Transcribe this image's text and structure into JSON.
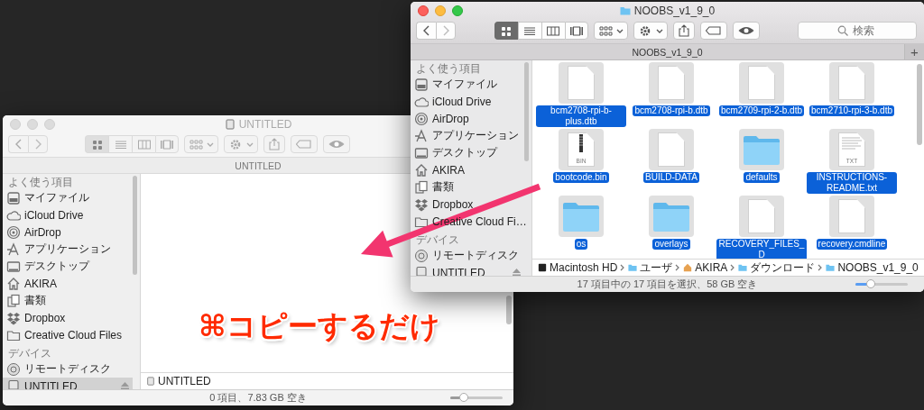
{
  "desktop": {
    "windows": [
      {
        "title": "UNTITLED",
        "active": false,
        "view_buttons": [
          {
            "kind": "icon",
            "selected": true
          },
          {
            "kind": "list",
            "selected": false
          },
          {
            "kind": "column",
            "selected": false
          },
          {
            "kind": "gallery",
            "selected": false
          }
        ],
        "tab_title": "UNTITLED",
        "sidebar": [
          {
            "heading": "よく使う項目",
            "items": [
              {
                "label": "マイファイル",
                "kind": "all-files",
                "selected": false
              },
              {
                "label": "iCloud Drive",
                "kind": "cloud",
                "selected": false
              },
              {
                "label": "AirDrop",
                "kind": "airdrop",
                "selected": false
              },
              {
                "label": "アプリケーション",
                "kind": "apps",
                "selected": false
              },
              {
                "label": "デスクトップ",
                "kind": "desktop",
                "selected": false
              },
              {
                "label": "AKIRA",
                "kind": "home",
                "selected": false
              },
              {
                "label": "書類",
                "kind": "documents",
                "selected": false
              },
              {
                "label": "Dropbox",
                "kind": "dropbox",
                "selected": false
              },
              {
                "label": "Creative Cloud Files",
                "kind": "folder",
                "selected": false
              }
            ]
          },
          {
            "heading": "デバイス",
            "items": [
              {
                "label": "リモートディスク",
                "kind": "disc",
                "selected": false,
                "eject": false
              },
              {
                "label": "UNTITLED",
                "kind": "drive",
                "selected": true,
                "eject": true
              }
            ]
          }
        ],
        "path": [
          {
            "label": "UNTITLED",
            "kind": "drive"
          }
        ],
        "status": "0 項目、7.83 GB 空き",
        "zoom": {
          "level": 0.25
        }
      },
      {
        "title": "NOOBS_v1_9_0",
        "active": true,
        "view_buttons": [
          {
            "kind": "icon",
            "selected": true
          },
          {
            "kind": "list",
            "selected": false
          },
          {
            "kind": "column",
            "selected": false
          },
          {
            "kind": "gallery",
            "selected": false
          }
        ],
        "search": {
          "placeholder": "検索"
        },
        "tab_title": "NOOBS_v1_9_0",
        "tab_add": "+",
        "sidebar": [
          {
            "heading": "よく使う項目",
            "items": [
              {
                "label": "マイファイル",
                "kind": "all-files",
                "selected": false
              },
              {
                "label": "iCloud Drive",
                "kind": "cloud",
                "selected": false
              },
              {
                "label": "AirDrop",
                "kind": "airdrop",
                "selected": false
              },
              {
                "label": "アプリケーション",
                "kind": "apps",
                "selected": false
              },
              {
                "label": "デスクトップ",
                "kind": "desktop",
                "selected": false
              },
              {
                "label": "AKIRA",
                "kind": "home",
                "selected": false
              },
              {
                "label": "書類",
                "kind": "documents",
                "selected": false
              },
              {
                "label": "Dropbox",
                "kind": "dropbox",
                "selected": false
              },
              {
                "label": "Creative Cloud Fi…",
                "kind": "folder",
                "selected": false
              }
            ]
          },
          {
            "heading": "デバイス",
            "items": [
              {
                "label": "リモートディスク",
                "kind": "disc",
                "selected": false,
                "eject": false
              },
              {
                "label": "UNTITLED",
                "kind": "drive",
                "selected": false,
                "eject": true
              }
            ]
          }
        ],
        "files": [
          {
            "name": "bcm2708-rpi-b-plus.dtb",
            "kind": "document",
            "selected": true
          },
          {
            "name": "bcm2708-rpi-b.dtb",
            "kind": "document",
            "selected": true
          },
          {
            "name": "bcm2709-rpi-2-b.dtb",
            "kind": "document",
            "selected": true
          },
          {
            "name": "bcm2710-rpi-3-b.dtb",
            "kind": "document",
            "selected": true
          },
          {
            "name": "bootcode.bin",
            "kind": "binary",
            "badge": "BIN",
            "selected": true
          },
          {
            "name": "BUILD-DATA",
            "kind": "document",
            "selected": true
          },
          {
            "name": "defaults",
            "kind": "folder",
            "selected": true
          },
          {
            "name": "INSTRUCTIONS-README.txt",
            "kind": "text",
            "badge": "TXT",
            "selected": true
          },
          {
            "name": "os",
            "kind": "folder",
            "selected": true
          },
          {
            "name": "overlays",
            "kind": "folder",
            "selected": true
          },
          {
            "name": "RECOVERY_FILES_D",
            "kind": "document",
            "selected": true
          },
          {
            "name": "recovery.cmdline",
            "kind": "document",
            "selected": true
          }
        ],
        "path": [
          {
            "label": "Macintosh HD",
            "kind": "hd"
          },
          {
            "label": "ユーザ",
            "kind": "user"
          },
          {
            "label": "AKIRA",
            "kind": "home"
          },
          {
            "label": "ダウンロード",
            "kind": "downloads"
          },
          {
            "label": "NOOBS_v1_9_0",
            "kind": "folder"
          }
        ],
        "status": "17 項目中の 17 項目を選択、58 GB 空き",
        "zoom": {
          "level": 0.3
        }
      }
    ]
  },
  "annotation": {
    "text": "⌘コピーするだけ"
  }
}
